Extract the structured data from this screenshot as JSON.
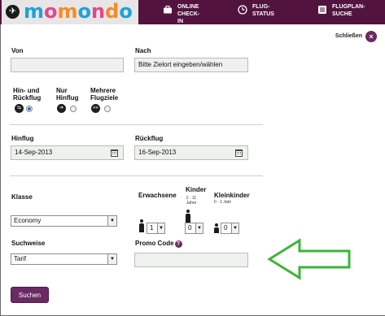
{
  "header": {
    "logo": {
      "letters": [
        {
          "ch": "m",
          "color": "#1aa3d9"
        },
        {
          "ch": "o",
          "color": "#e3478a"
        },
        {
          "ch": "m",
          "color": "#f28c28"
        },
        {
          "ch": "o",
          "color": "#1aa3d9"
        },
        {
          "ch": "n",
          "color": "#e3478a"
        },
        {
          "ch": "d",
          "color": "#f28c28"
        },
        {
          "ch": "o",
          "color": "#1aa3d9"
        }
      ]
    },
    "nav": [
      {
        "label": "ONLINE\nCHECK-IN",
        "icon": "briefcase-icon"
      },
      {
        "label": "FLUG-\nSTATUS",
        "icon": "clock-icon"
      },
      {
        "label": "FLUGPLAN-\nSUCHE",
        "icon": "list-icon"
      }
    ],
    "background_color": "#52143f"
  },
  "close": {
    "label": "Schließen",
    "symbol": "×"
  },
  "from": {
    "label": "Von",
    "value": "",
    "placeholder": ""
  },
  "to": {
    "label": "Nach",
    "value": "",
    "placeholder": "Bitte Zielort eingeben/wählen"
  },
  "trip_types": [
    {
      "label": "Hin- und\nRückflug",
      "icon_glyph": "⇆",
      "selected": true
    },
    {
      "label": "Nur\nHinflug",
      "icon_glyph": "➔",
      "selected": false
    },
    {
      "label": "Mehrere\nFlugziele",
      "icon_glyph": "»»",
      "selected": false
    }
  ],
  "departure": {
    "label": "Hinflug",
    "value": "14-Sep-2013"
  },
  "return": {
    "label": "Rückflug",
    "value": "16-Sep-2013"
  },
  "class": {
    "label": "Klasse",
    "value": "Economy"
  },
  "passengers": {
    "adults": {
      "label": "Erwachsene",
      "value": "1"
    },
    "children": {
      "label": "Kinder",
      "sublabel": "2 - 11\nJahre",
      "value": "0"
    },
    "infants": {
      "label": "Kleinkinder",
      "sublabel": "0 - 1 Jahr",
      "value": "0"
    }
  },
  "fare": {
    "label": "Suchweise",
    "value": "Tarif"
  },
  "promo": {
    "label": "Promo Code",
    "help": "?",
    "value": ""
  },
  "search_button": {
    "label": "Suchen"
  },
  "colors": {
    "brand": "#6b2a63",
    "arrow_green": "#3db53a"
  }
}
